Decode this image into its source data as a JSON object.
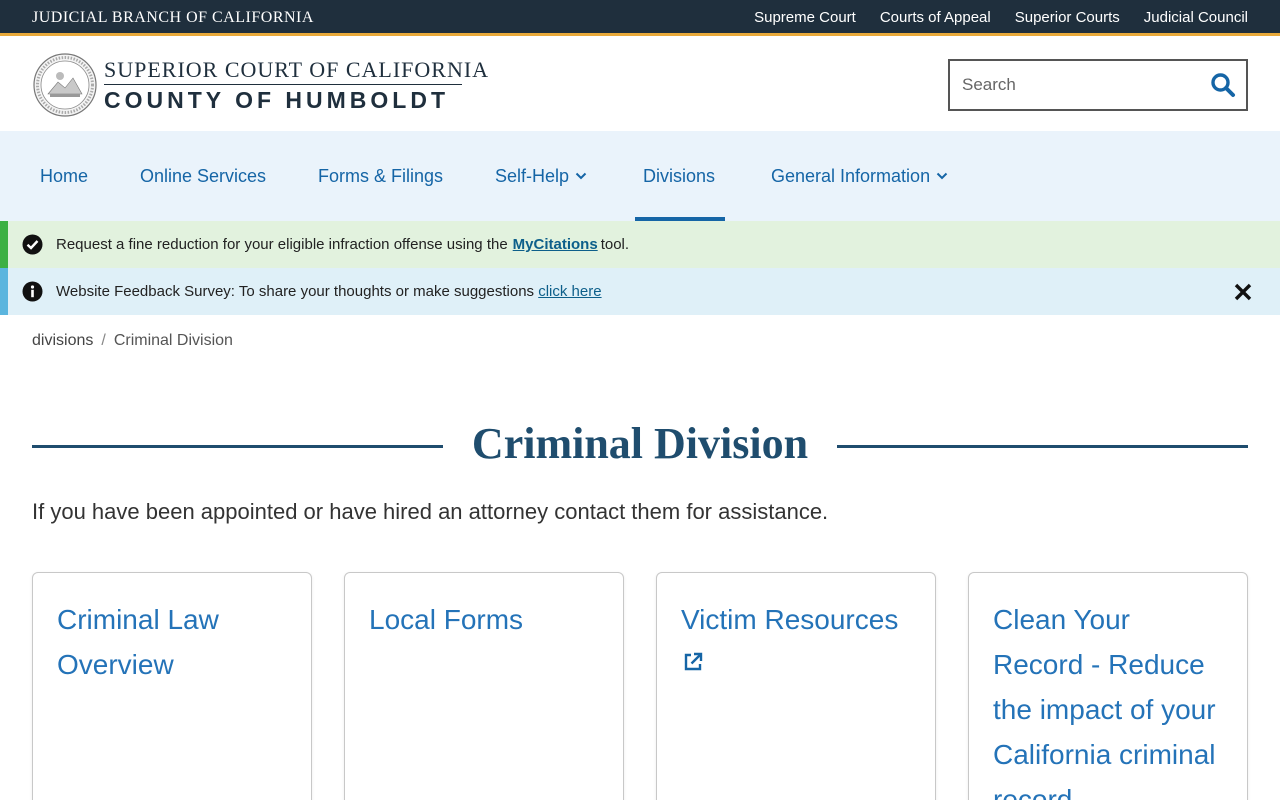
{
  "topbar": {
    "branch": "JUDICIAL BRANCH OF CALIFORNIA",
    "links": [
      "Supreme Court",
      "Courts of Appeal",
      "Superior Courts",
      "Judicial Council"
    ]
  },
  "header": {
    "line1": "SUPERIOR COURT OF CALIFORNIA",
    "line2": "COUNTY OF HUMBOLDT",
    "search_placeholder": "Search"
  },
  "nav": {
    "items": [
      {
        "label": "Home",
        "dropdown": false,
        "active": false
      },
      {
        "label": "Online Services",
        "dropdown": false,
        "active": false
      },
      {
        "label": "Forms & Filings",
        "dropdown": false,
        "active": false
      },
      {
        "label": "Self-Help",
        "dropdown": true,
        "active": false
      },
      {
        "label": "Divisions",
        "dropdown": false,
        "active": true
      },
      {
        "label": "General Information",
        "dropdown": true,
        "active": false
      }
    ]
  },
  "alerts": {
    "citation": {
      "before": "Request a fine reduction for your eligible infraction offense using the",
      "link": "MyCitations",
      "after": "tool."
    },
    "survey": {
      "before": "Website Feedback Survey: To share your thoughts or make suggestions",
      "link": "click here"
    }
  },
  "breadcrumb": {
    "parent": "divisions",
    "separator": "/",
    "current": "Criminal Division"
  },
  "main": {
    "title": "Criminal Division",
    "intro": "If you have been appointed or have hired an attorney contact them for assistance.",
    "cards": [
      {
        "title": "Criminal Law Overview",
        "external": false
      },
      {
        "title": "Local Forms",
        "external": false
      },
      {
        "title": "Victim Resources",
        "external": true
      },
      {
        "title": "Clean Your Record - Reduce the impact of your California criminal record",
        "external": false
      }
    ]
  },
  "colors": {
    "topbar": "#1f2f3d",
    "accent": "#e8a93a",
    "link": "#1565a6",
    "nav_bg": "#eaf3fb",
    "success": "#3cb043",
    "info": "#5bb5de"
  }
}
